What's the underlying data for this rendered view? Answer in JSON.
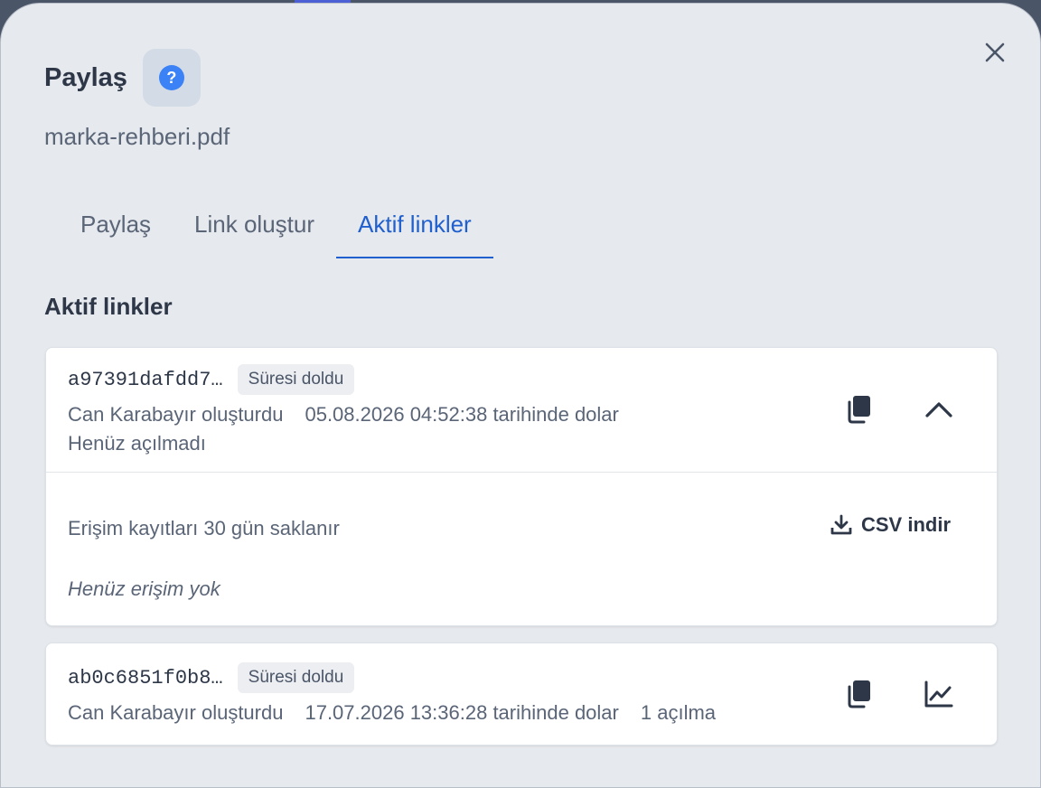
{
  "dialog": {
    "title": "Paylaş",
    "help_icon": "?",
    "filename": "marka-rehberi.pdf",
    "tabs": [
      {
        "label": "Paylaş",
        "active": false
      },
      {
        "label": "Link oluştur",
        "active": false
      },
      {
        "label": "Aktif linkler",
        "active": true
      }
    ],
    "section_title": "Aktif linkler"
  },
  "links": [
    {
      "id": "a97391dafdd7…",
      "status": "Süresi doldu",
      "creator": "Can Karabayır oluşturdu",
      "expiry": "05.08.2026 04:52:38 tarihinde dolar",
      "opens": "Henüz açılmadı",
      "expanded": true,
      "log_note": "Erişim kayıtları 30 gün saklanır",
      "csv_label": "CSV indir",
      "empty_note": "Henüz erişim yok"
    },
    {
      "id": "ab0c6851f0b8…",
      "status": "Süresi doldu",
      "creator": "Can Karabayır oluşturdu",
      "expiry": "17.07.2026 13:36:28 tarihinde dolar",
      "opens": "1 açılma",
      "expanded": false
    }
  ],
  "icons": {
    "close": "close-icon",
    "help": "help-icon",
    "copy": "copy-icon",
    "collapse": "chevron-up-icon",
    "stats": "chart-line-icon",
    "download": "download-icon"
  },
  "colors": {
    "accent": "#1f5fce",
    "help": "#3b82f6",
    "dialog_bg": "#e6e9ed",
    "card_bg": "#ffffff"
  }
}
